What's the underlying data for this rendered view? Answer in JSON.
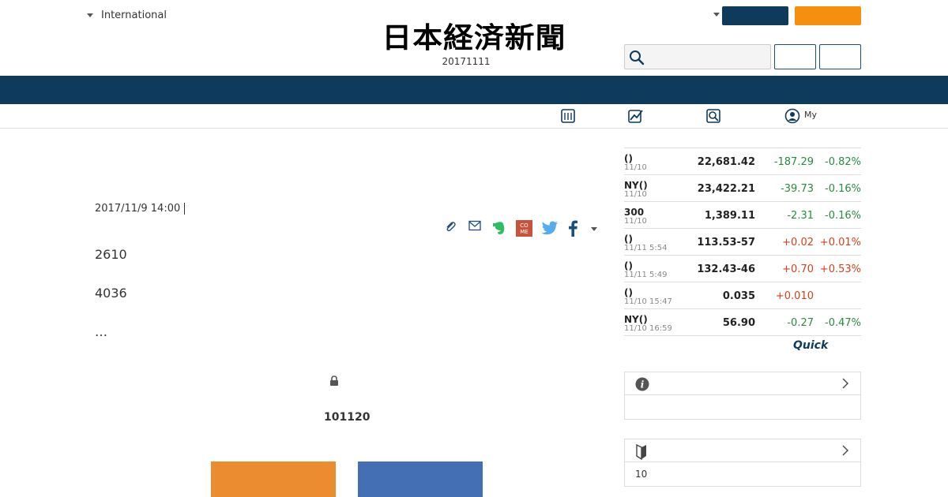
{
  "header": {
    "region_label": "International",
    "logo_text": "日本経済新聞",
    "date": "20171111"
  },
  "subnav": {
    "my_label": "My"
  },
  "article": {
    "date": "2017/11/9 14:00",
    "paragraphs": [
      "2610",
      "4036",
      "…"
    ],
    "paywall_number": "101120"
  },
  "market": {
    "rows": [
      {
        "name": "()",
        "time": "11/10",
        "value": "22,681.42",
        "change": "-187.29",
        "pct": "-0.82%",
        "dir": "neg"
      },
      {
        "name": "NY()",
        "time": "11/10",
        "value": "23,422.21",
        "change": "-39.73",
        "pct": "-0.16%",
        "dir": "neg"
      },
      {
        "name": "300",
        "time": "11/10",
        "value": "1,389.11",
        "change": "-2.31",
        "pct": "-0.16%",
        "dir": "neg"
      },
      {
        "name": "()",
        "time": "11/11 5:54",
        "value": "113.53-57",
        "change": "+0.02",
        "pct": "+0.01%",
        "dir": "pos"
      },
      {
        "name": "()",
        "time": "11/11 5:49",
        "value": "132.43-46",
        "change": "+0.70",
        "pct": "+0.53%",
        "dir": "pos"
      },
      {
        "name": "()",
        "time": "11/10 15:47",
        "value": "0.035",
        "change": "+0.010",
        "pct": "",
        "dir": "pos"
      },
      {
        "name": "NY()",
        "time": "11/10 16:59",
        "value": "56.90",
        "change": "-0.27",
        "pct": "-0.47%",
        "dir": "neg"
      }
    ],
    "source_logo": "Quick"
  },
  "panels": {
    "beginner_body": "10"
  },
  "colors": {
    "navy": "#0e3a5c",
    "orange": "#f5900e",
    "negative": "#2a8a3e",
    "positive": "#d0421b"
  },
  "icons": {
    "share": [
      "clip-icon",
      "mail-icon",
      "evernote-icon",
      "come-icon",
      "twitter-icon",
      "facebook-icon",
      "more-caret-icon"
    ],
    "subnav": [
      "calculator-icon",
      "chart-icon",
      "search-icon",
      "my-user-icon"
    ]
  }
}
